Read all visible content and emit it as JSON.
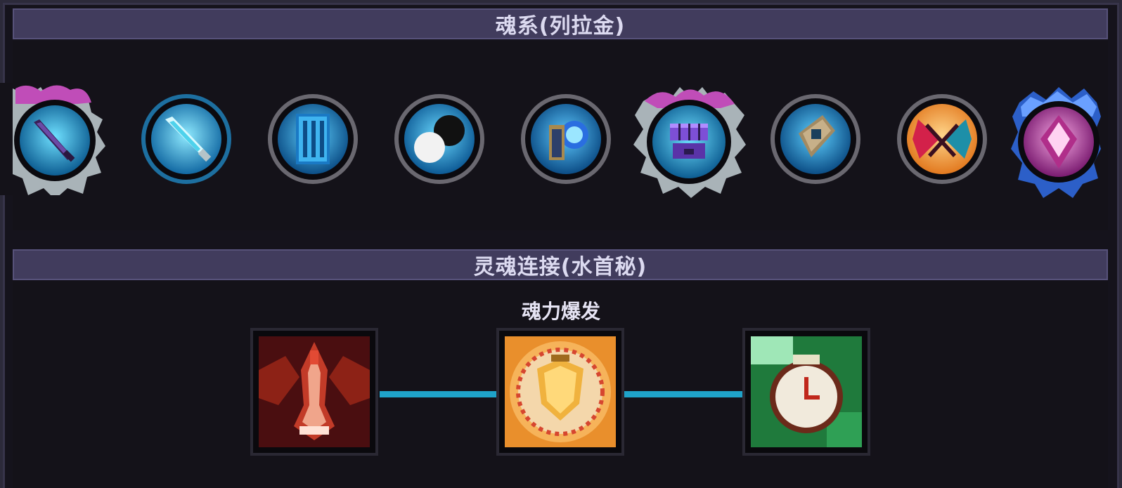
{
  "soul_system": {
    "title": "魂系(列拉金)",
    "runes": [
      {
        "icon": "dark-sword-icon",
        "style": "spiked-pink"
      },
      {
        "icon": "crystal-sword-icon",
        "style": "blue-ring"
      },
      {
        "icon": "blue-scroll-icon",
        "style": "grey-ring"
      },
      {
        "icon": "black-white-orb-icon",
        "style": "grey-ring"
      },
      {
        "icon": "blue-gauntlet-icon",
        "style": "grey-ring"
      },
      {
        "icon": "purple-fist-icon",
        "style": "spiked-pink"
      },
      {
        "icon": "stone-tablet-icon",
        "style": "grey-ring"
      },
      {
        "icon": "crimson-wings-icon",
        "style": "grey-ring"
      },
      {
        "icon": "pink-crystal-icon",
        "style": "spiked-blue"
      }
    ]
  },
  "soul_link": {
    "title": "灵魂连接(水首秘)",
    "active_label": "魂力爆发",
    "skills": [
      {
        "icon": "red-spirit-icon"
      },
      {
        "icon": "golden-shield-icon"
      },
      {
        "icon": "green-clock-icon"
      }
    ]
  },
  "colors": {
    "header_bg": "#413c5d",
    "panel_bg": "#141219",
    "link_line": "#1fa3c9"
  }
}
